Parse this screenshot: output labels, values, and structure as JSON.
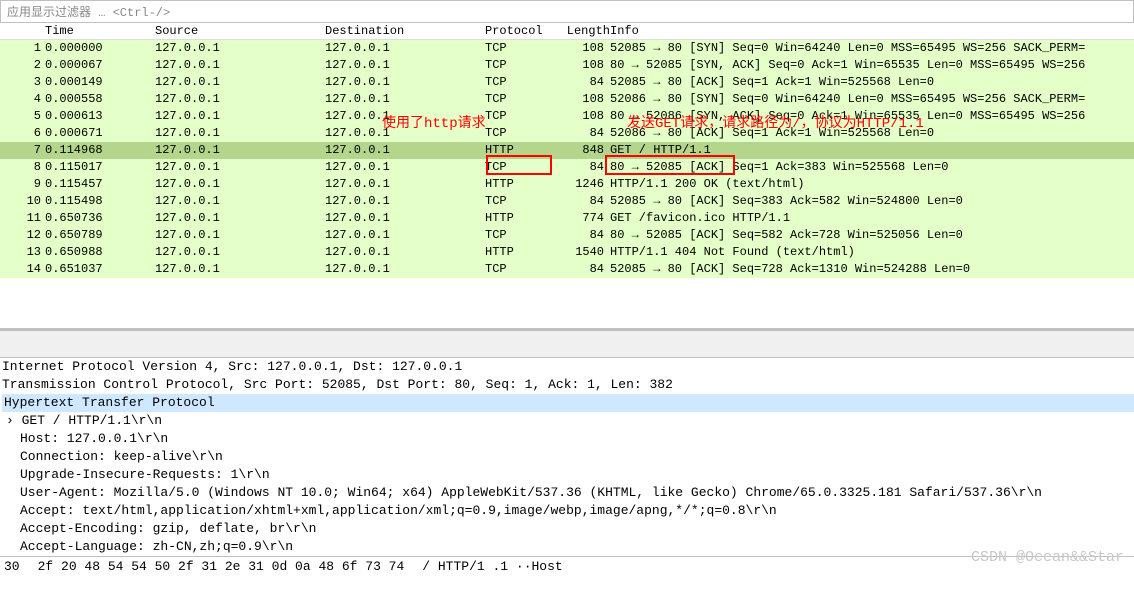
{
  "filter": {
    "placeholder": "应用显示过滤器 … <Ctrl-/>"
  },
  "headers": {
    "no": "",
    "time": "Time",
    "src": "Source",
    "dst": "Destination",
    "proto": "Protocol",
    "len": "Length",
    "info": "Info"
  },
  "packets": [
    {
      "n": 1,
      "t": "0.000000",
      "s": "127.0.0.1",
      "d": "127.0.0.1",
      "p": "TCP",
      "l": 108,
      "i": "52085 → 80 [SYN] Seq=0 Win=64240 Len=0 MSS=65495 WS=256 SACK_PERM=",
      "cls": "green"
    },
    {
      "n": 2,
      "t": "0.000067",
      "s": "127.0.0.1",
      "d": "127.0.0.1",
      "p": "TCP",
      "l": 108,
      "i": "80 → 52085 [SYN, ACK] Seq=0 Ack=1 Win=65535 Len=0 MSS=65495 WS=256",
      "cls": "green"
    },
    {
      "n": 3,
      "t": "0.000149",
      "s": "127.0.0.1",
      "d": "127.0.0.1",
      "p": "TCP",
      "l": 84,
      "i": "52085 → 80 [ACK] Seq=1 Ack=1 Win=525568 Len=0",
      "cls": "green"
    },
    {
      "n": 4,
      "t": "0.000558",
      "s": "127.0.0.1",
      "d": "127.0.0.1",
      "p": "TCP",
      "l": 108,
      "i": "52086 → 80 [SYN] Seq=0 Win=64240 Len=0 MSS=65495 WS=256 SACK_PERM=",
      "cls": "green"
    },
    {
      "n": 5,
      "t": "0.000613",
      "s": "127.0.0.1",
      "d": "127.0.0.1",
      "p": "TCP",
      "l": 108,
      "i": "80 → 52086 [SYN, ACK] Seq=0 Ack=1 Win=65535 Len=0 MSS=65495 WS=256",
      "cls": "green"
    },
    {
      "n": 6,
      "t": "0.000671",
      "s": "127.0.0.1",
      "d": "127.0.0.1",
      "p": "TCP",
      "l": 84,
      "i": "52086 → 80 [ACK] Seq=1 Ack=1 Win=525568 Len=0",
      "cls": "green"
    },
    {
      "n": 7,
      "t": "0.114968",
      "s": "127.0.0.1",
      "d": "127.0.0.1",
      "p": "HTTP",
      "l": 848,
      "i": "GET / HTTP/1.1",
      "cls": "selected"
    },
    {
      "n": 8,
      "t": "0.115017",
      "s": "127.0.0.1",
      "d": "127.0.0.1",
      "p": "TCP",
      "l": 84,
      "i": "80 → 52085 [ACK] Seq=1 Ack=383 Win=525568 Len=0",
      "cls": "green"
    },
    {
      "n": 9,
      "t": "0.115457",
      "s": "127.0.0.1",
      "d": "127.0.0.1",
      "p": "HTTP",
      "l": 1246,
      "i": "HTTP/1.1 200 OK  (text/html)",
      "cls": "green"
    },
    {
      "n": 10,
      "t": "0.115498",
      "s": "127.0.0.1",
      "d": "127.0.0.1",
      "p": "TCP",
      "l": 84,
      "i": "52085 → 80 [ACK] Seq=383 Ack=582 Win=524800 Len=0",
      "cls": "green"
    },
    {
      "n": 11,
      "t": "0.650736",
      "s": "127.0.0.1",
      "d": "127.0.0.1",
      "p": "HTTP",
      "l": 774,
      "i": "GET /favicon.ico HTTP/1.1",
      "cls": "green"
    },
    {
      "n": 12,
      "t": "0.650789",
      "s": "127.0.0.1",
      "d": "127.0.0.1",
      "p": "TCP",
      "l": 84,
      "i": "80 → 52085 [ACK] Seq=582 Ack=728 Win=525056 Len=0",
      "cls": "green"
    },
    {
      "n": 13,
      "t": "0.650988",
      "s": "127.0.0.1",
      "d": "127.0.0.1",
      "p": "HTTP",
      "l": 1540,
      "i": "HTTP/1.1 404 Not Found  (text/html)",
      "cls": "green"
    },
    {
      "n": 14,
      "t": "0.651037",
      "s": "127.0.0.1",
      "d": "127.0.0.1",
      "p": "TCP",
      "l": 84,
      "i": "52085 → 80 [ACK] Seq=728 Ack=1310 Win=524288 Len=0",
      "cls": "green"
    }
  ],
  "anno": {
    "a1": "使用了http请求",
    "a2": "发送GET请求，请求路径为/，协议为HTTP/1.1"
  },
  "detail": {
    "ip": "Internet Protocol Version 4, Src: 127.0.0.1, Dst: 127.0.0.1",
    "tcp": "Transmission Control Protocol, Src Port: 52085, Dst Port: 80, Seq: 1, Ack: 1, Len: 382",
    "htp": "Hypertext Transfer Protocol",
    "get": "› GET / HTTP/1.1\\r\\n",
    "lines": [
      "Host: 127.0.0.1\\r\\n",
      "Connection: keep-alive\\r\\n",
      "Upgrade-Insecure-Requests: 1\\r\\n",
      "User-Agent: Mozilla/5.0 (Windows NT 10.0; Win64; x64) AppleWebKit/537.36 (KHTML, like Gecko) Chrome/65.0.3325.181 Safari/537.36\\r\\n",
      "Accept: text/html,application/xhtml+xml,application/xml;q=0.9,image/webp,image/apng,*/*;q=0.8\\r\\n",
      "Accept-Encoding: gzip, deflate, br\\r\\n",
      "Accept-Language: zh-CN,zh;q=0.9\\r\\n"
    ]
  },
  "hex": {
    "off": "30",
    "bytes": "2f 20 48 54 54 50 2f 31  2e 31 0d 0a 48 6f 73 74",
    "ascii": "/ HTTP/1 .1 ··Host"
  },
  "watermark": "CSDN @Ocean&&Star"
}
